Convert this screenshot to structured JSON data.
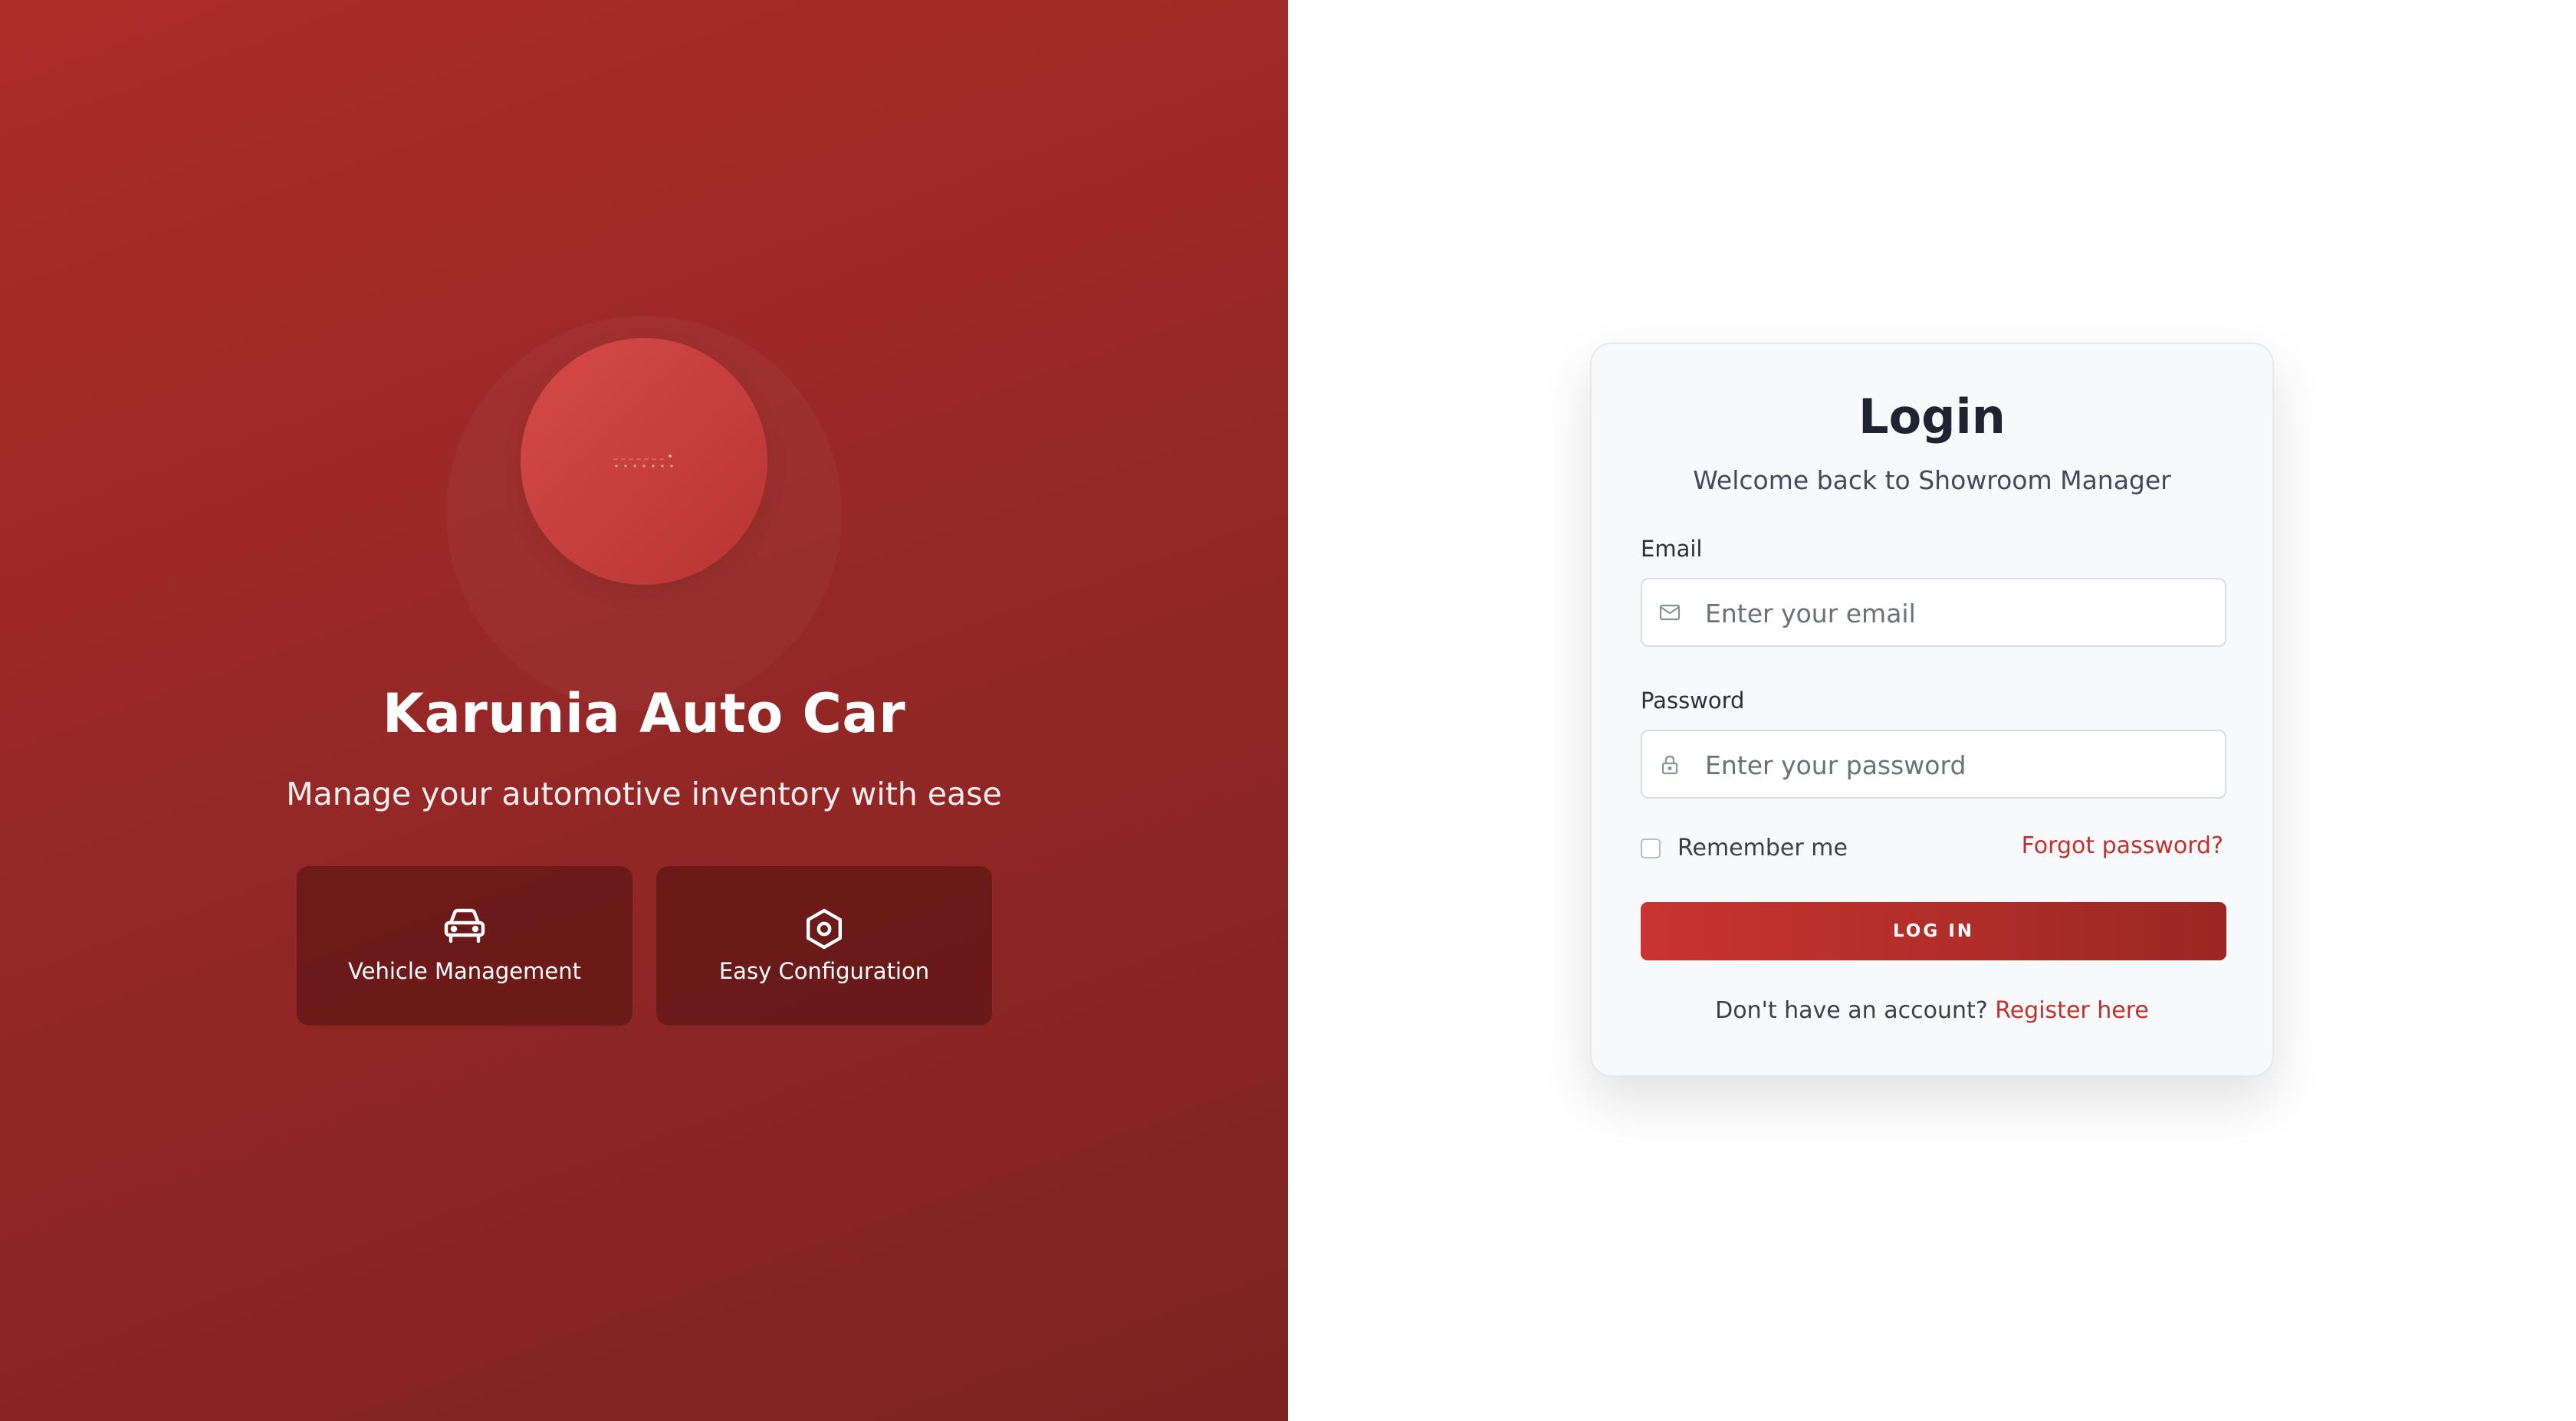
{
  "brand": {
    "title": "Karunia Auto Car",
    "subtitle": "Manage your automotive inventory with ease"
  },
  "features": [
    {
      "label": "Vehicle Management",
      "icon": "car-icon"
    },
    {
      "label": "Easy Configuration",
      "icon": "hexagon-settings-icon"
    }
  ],
  "login": {
    "title": "Login",
    "subtitle": "Welcome back to Showroom Manager",
    "email_label": "Email",
    "email_placeholder": "Enter your email",
    "email_icon": "mail-icon",
    "password_label": "Password",
    "password_placeholder": "Enter your password",
    "password_icon": "lock-icon",
    "remember_label": "Remember me",
    "forgot_label": "Forgot password?",
    "submit_label": "LOG IN",
    "register_prompt": "Don't have an account?",
    "register_link": "Register here"
  },
  "colors": {
    "brand_red": "#b83330",
    "accent_link": "#c0312d",
    "card_bg": "#f8f9fb"
  }
}
